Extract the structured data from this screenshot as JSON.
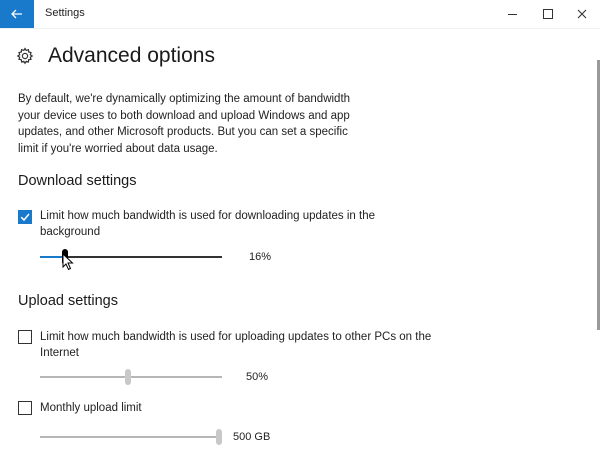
{
  "window": {
    "title": "Settings",
    "controls": {
      "minimize": "—",
      "maximize": "☐",
      "close": "✕"
    }
  },
  "page": {
    "title": "Advanced options",
    "icon": "gear-icon",
    "description": "By default, we're dynamically optimizing the amount of bandwidth your device uses to both download and upload Windows and app updates, and other Microsoft products. But you can set a specific limit if you're worried about data usage."
  },
  "download": {
    "title": "Download settings",
    "limit_checkbox": {
      "label": "Limit how much bandwidth is used for downloading updates in the background",
      "checked": true
    },
    "slider": {
      "value": 16,
      "value_text": "16%"
    }
  },
  "upload": {
    "title": "Upload settings",
    "limit_checkbox": {
      "label": "Limit how much bandwidth is used for uploading updates to other PCs on the Internet",
      "checked": false
    },
    "slider": {
      "value": 50,
      "value_text": "50%"
    },
    "monthly_checkbox": {
      "label": "Monthly upload limit",
      "checked": false
    },
    "monthly_slider": {
      "value": 100,
      "value_text": "500 GB"
    }
  },
  "colors": {
    "accent": "#1979ca",
    "titlebar_bg": "#ffffff",
    "text": "#1a1a1a"
  }
}
